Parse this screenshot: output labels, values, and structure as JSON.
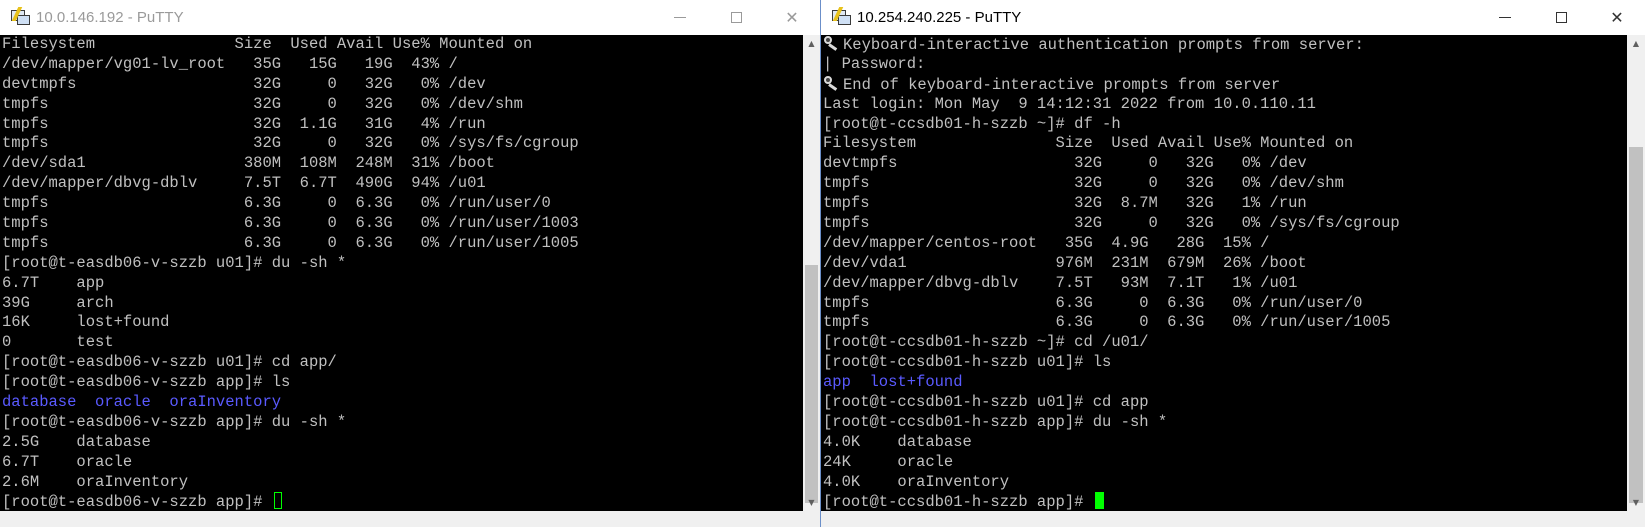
{
  "left_window": {
    "title": "10.0.146.192 - PuTTY",
    "lines": [
      {
        "text": "Filesystem               Size  Used Avail Use% Mounted on"
      },
      {
        "text": "/dev/mapper/vg01-lv_root   35G   15G   19G  43% /"
      },
      {
        "text": "devtmpfs                   32G     0   32G   0% /dev"
      },
      {
        "text": "tmpfs                      32G     0   32G   0% /dev/shm"
      },
      {
        "text": "tmpfs                      32G  1.1G   31G   4% /run"
      },
      {
        "text": "tmpfs                      32G     0   32G   0% /sys/fs/cgroup"
      },
      {
        "text": "/dev/sda1                 380M  108M  248M  31% /boot"
      },
      {
        "text": "/dev/mapper/dbvg-dblv     7.5T  6.7T  490G  94% /u01"
      },
      {
        "text": "tmpfs                     6.3G     0  6.3G   0% /run/user/0"
      },
      {
        "text": "tmpfs                     6.3G     0  6.3G   0% /run/user/1003"
      },
      {
        "text": "tmpfs                     6.3G     0  6.3G   0% /run/user/1005"
      },
      {
        "text": "[root@t-easdb06-v-szzb u01]# du -sh *"
      },
      {
        "text": "6.7T    app"
      },
      {
        "text": "39G     arch"
      },
      {
        "text": "16K     lost+found"
      },
      {
        "text": "0       test"
      },
      {
        "text": "[root@t-easdb06-v-szzb u01]# cd app/"
      },
      {
        "text": "[root@t-easdb06-v-szzb app]# ls"
      },
      {
        "text": "database  oracle  oraInventory",
        "color": "blue"
      },
      {
        "text": "[root@t-easdb06-v-szzb app]# du -sh *"
      },
      {
        "text": "2.5G    database"
      },
      {
        "text": "6.7T    oracle"
      },
      {
        "text": "2.6M    oraInventory"
      }
    ],
    "prompt": "[root@t-easdb06-v-szzb app]# "
  },
  "right_window": {
    "title": "10.254.240.225 - PuTTY",
    "lines": [
      {
        "text": "Keyboard-interactive authentication prompts from server:",
        "icon": "key-icon"
      },
      {
        "text": "| Password:"
      },
      {
        "text": "End of keyboard-interactive prompts from server",
        "icon": "key-icon"
      },
      {
        "text": "Last login: Mon May  9 14:12:31 2022 from 10.0.110.11"
      },
      {
        "text": "[root@t-ccsdb01-h-szzb ~]# df -h"
      },
      {
        "text": "Filesystem               Size  Used Avail Use% Mounted on"
      },
      {
        "text": "devtmpfs                   32G     0   32G   0% /dev"
      },
      {
        "text": "tmpfs                      32G     0   32G   0% /dev/shm"
      },
      {
        "text": "tmpfs                      32G  8.7M   32G   1% /run"
      },
      {
        "text": "tmpfs                      32G     0   32G   0% /sys/fs/cgroup"
      },
      {
        "text": "/dev/mapper/centos-root   35G  4.9G   28G  15% /"
      },
      {
        "text": "/dev/vda1                976M  231M  679M  26% /boot"
      },
      {
        "text": "/dev/mapper/dbvg-dblv    7.5T   93M  7.1T   1% /u01"
      },
      {
        "text": "tmpfs                    6.3G     0  6.3G   0% /run/user/0"
      },
      {
        "text": "tmpfs                    6.3G     0  6.3G   0% /run/user/1005"
      },
      {
        "text": "[root@t-ccsdb01-h-szzb ~]# cd /u01/"
      },
      {
        "text": "[root@t-ccsdb01-h-szzb u01]# ls"
      },
      {
        "text": "app  lost+found",
        "color": "blue"
      },
      {
        "text": "[root@t-ccsdb01-h-szzb u01]# cd app"
      },
      {
        "text": "[root@t-ccsdb01-h-szzb app]# du -sh *"
      },
      {
        "text": "4.0K    database"
      },
      {
        "text": "24K     oracle"
      },
      {
        "text": "4.0K    oraInventory"
      }
    ],
    "prompt": "[root@t-ccsdb01-h-szzb app]# "
  },
  "colors": {
    "terminal_bg": "#000000",
    "terminal_fg": "#c0c0c0",
    "dir_blue": "#5a5aff",
    "cursor_green": "#00ff00"
  }
}
